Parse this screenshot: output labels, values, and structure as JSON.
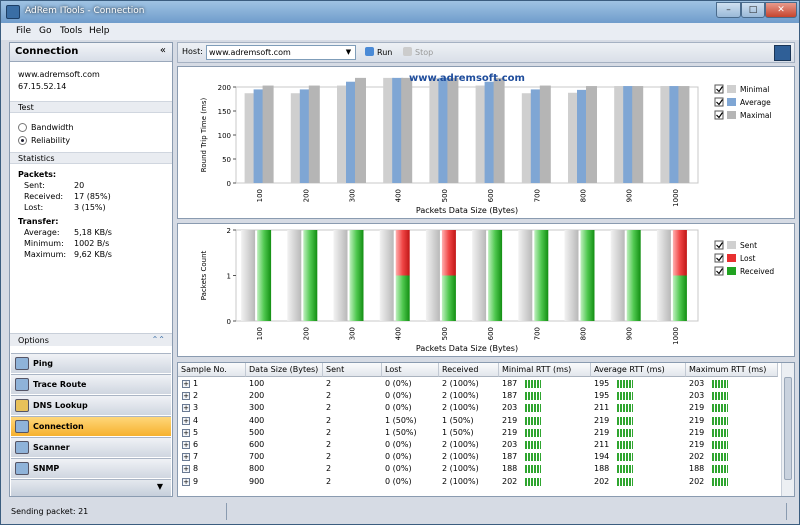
{
  "window": {
    "title": "AdRem ITools - Connection"
  },
  "menu": [
    "File",
    "Go",
    "Tools",
    "Help"
  ],
  "left": {
    "header": "Connection",
    "collapse": "«",
    "host": "www.adremsoft.com",
    "ip": "67.15.52.14",
    "test_label": "Test",
    "test_options": [
      {
        "label": "Bandwidth",
        "selected": false
      },
      {
        "label": "Reliability",
        "selected": true
      }
    ],
    "statistics_label": "Statistics",
    "packets_label": "Packets:",
    "packets": [
      {
        "label": "Sent:",
        "value": "20"
      },
      {
        "label": "Received:",
        "value": "17 (85%)"
      },
      {
        "label": "Lost:",
        "value": "3 (15%)"
      }
    ],
    "transfer_label": "Transfer:",
    "transfer": [
      {
        "label": "Average:",
        "value": "5,18 KB/s"
      },
      {
        "label": "Minimum:",
        "value": "1002 B/s"
      },
      {
        "label": "Maximum:",
        "value": "9,62 KB/s"
      }
    ],
    "options_label": "Options",
    "options_icon": "double-chevron-up-icon"
  },
  "nav": [
    {
      "label": "Ping",
      "selected": false,
      "icon": "ping-icon"
    },
    {
      "label": "Trace Route",
      "selected": false,
      "icon": "trace-route-icon"
    },
    {
      "label": "DNS Lookup",
      "selected": false,
      "icon": "dns-lookup-icon"
    },
    {
      "label": "Connection",
      "selected": true,
      "icon": "connection-icon"
    },
    {
      "label": "Scanner",
      "selected": false,
      "icon": "scanner-icon"
    },
    {
      "label": "SNMP",
      "selected": false,
      "icon": "snmp-icon"
    }
  ],
  "toolbar": {
    "host_label": "Host:",
    "host_value": "www.adremsoft.com",
    "run_label": "Run",
    "stop_label": "Stop"
  },
  "chart_data": [
    {
      "type": "bar",
      "title": "www.adremsoft.com",
      "xlabel": "Packets Data Size (Bytes)",
      "ylabel": "Round Trip Time (ms)",
      "categories": [
        "100",
        "200",
        "300",
        "400",
        "500",
        "600",
        "700",
        "800",
        "900",
        "1000"
      ],
      "ylim": [
        0,
        200
      ],
      "yticks": [
        0,
        50,
        100,
        150,
        200
      ],
      "legend_position": "right",
      "series": [
        {
          "name": "Minimal",
          "color": "#cfcfcf",
          "values": [
            187,
            187,
            203,
            219,
            219,
            203,
            187,
            188,
            202,
            202
          ]
        },
        {
          "name": "Average",
          "color": "#7fa6d4",
          "values": [
            195,
            195,
            211,
            219,
            219,
            211,
            195,
            194,
            202,
            202
          ]
        },
        {
          "name": "Maximal",
          "color": "#b5b5b5",
          "values": [
            203,
            203,
            219,
            219,
            219,
            219,
            203,
            202,
            202,
            202
          ]
        }
      ]
    },
    {
      "type": "bar",
      "xlabel": "Packets Data Size (Bytes)",
      "ylabel": "Packets Count",
      "categories": [
        "100",
        "200",
        "300",
        "400",
        "500",
        "600",
        "700",
        "800",
        "900",
        "1000"
      ],
      "ylim": [
        0,
        2
      ],
      "yticks": [
        0,
        1,
        2
      ],
      "legend_position": "right",
      "series": [
        {
          "name": "Sent",
          "color": "#d0d0d0",
          "values": [
            2,
            2,
            2,
            2,
            2,
            2,
            2,
            2,
            2,
            2
          ]
        },
        {
          "name": "Lost",
          "color": "#e83030",
          "values": [
            0,
            0,
            0,
            1,
            1,
            0,
            0,
            0,
            0,
            1
          ]
        },
        {
          "name": "Received",
          "color": "#21a321",
          "values": [
            2,
            2,
            2,
            1,
            1,
            2,
            2,
            2,
            2,
            1
          ]
        }
      ]
    }
  ],
  "table": {
    "columns": [
      "Sample No.",
      "Data Size (Bytes)",
      "Sent",
      "Lost",
      "Received",
      "Minimal RTT (ms)",
      "Average RTT (ms)",
      "Maximum RTT (ms)"
    ],
    "rows": [
      [
        "1",
        "100",
        "2",
        "0 (0%)",
        "2 (100%)",
        "187",
        "195",
        "203"
      ],
      [
        "2",
        "200",
        "2",
        "0 (0%)",
        "2 (100%)",
        "187",
        "195",
        "203"
      ],
      [
        "3",
        "300",
        "2",
        "0 (0%)",
        "2 (100%)",
        "203",
        "211",
        "219"
      ],
      [
        "4",
        "400",
        "2",
        "1 (50%)",
        "1 (50%)",
        "219",
        "219",
        "219"
      ],
      [
        "5",
        "500",
        "2",
        "1 (50%)",
        "1 (50%)",
        "219",
        "219",
        "219"
      ],
      [
        "6",
        "600",
        "2",
        "0 (0%)",
        "2 (100%)",
        "203",
        "211",
        "219"
      ],
      [
        "7",
        "700",
        "2",
        "0 (0%)",
        "2 (100%)",
        "187",
        "194",
        "202"
      ],
      [
        "8",
        "800",
        "2",
        "0 (0%)",
        "2 (100%)",
        "188",
        "188",
        "188"
      ],
      [
        "9",
        "900",
        "2",
        "0 (0%)",
        "2 (100%)",
        "202",
        "202",
        "202"
      ]
    ]
  },
  "status": {
    "text": "Sending packet: 21"
  }
}
